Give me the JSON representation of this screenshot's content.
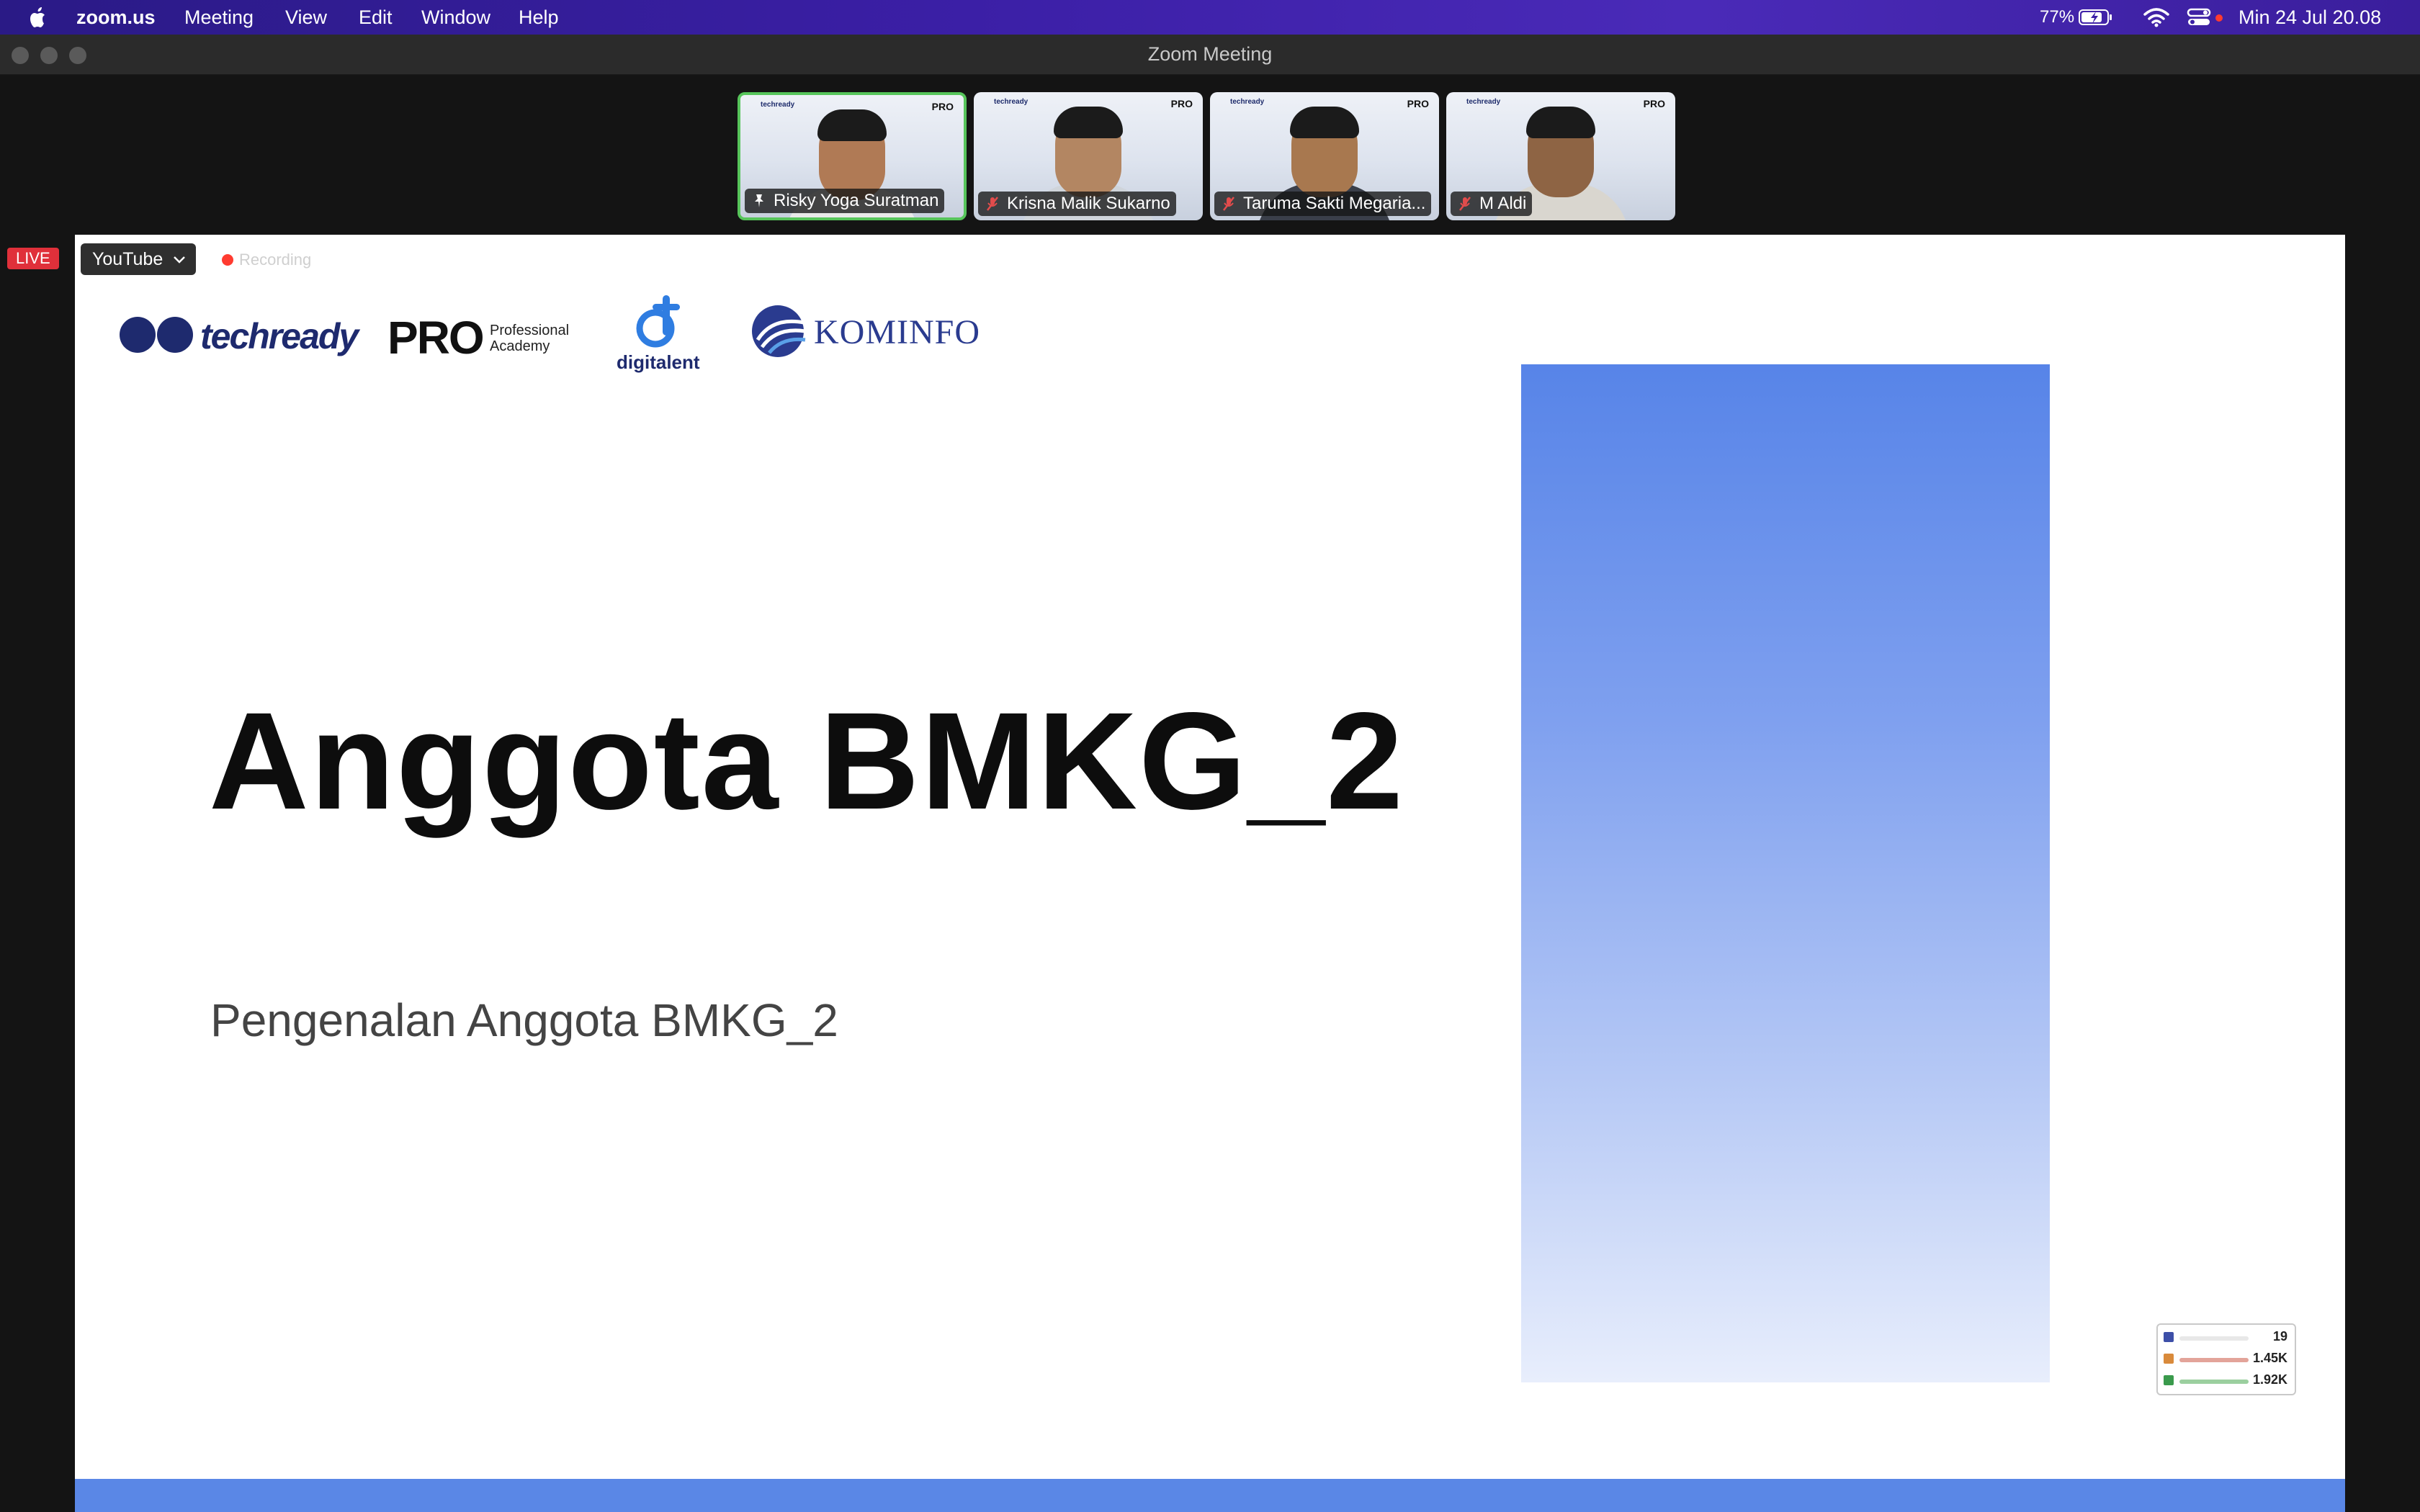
{
  "menubar": {
    "app_name": "zoom.us",
    "items": [
      "Meeting",
      "View",
      "Edit",
      "Window",
      "Help"
    ],
    "battery_percent": "77%",
    "datetime": "Min 24 Jul  20.08"
  },
  "window": {
    "title": "Zoom Meeting"
  },
  "participants": [
    {
      "name": "Risky Yoga Suratman",
      "active": true,
      "muted": false
    },
    {
      "name": "Krisna Malik Sukarno",
      "active": false,
      "muted": true
    },
    {
      "name": "Taruma Sakti Megaria...",
      "active": false,
      "muted": true
    },
    {
      "name": "M Aldi",
      "active": false,
      "muted": true
    }
  ],
  "tile_banner": {
    "brand": "techready",
    "pro": "PRO"
  },
  "live_controls": {
    "live_label": "LIVE",
    "stream_target": "YouTube",
    "recording_label": "Recording"
  },
  "slide": {
    "logos": {
      "techready": "techready",
      "pro": "PRO",
      "pro_sub_1": "Professional",
      "pro_sub_2": "Academy",
      "digitalent": "digitalent",
      "kominfo": "KOMINFO"
    },
    "title": "Anggota BMKG_2",
    "subtitle": "Pengenalan Anggota BMKG_2",
    "accent_color": "#5784e8"
  },
  "stats_widget": {
    "rows": [
      "19",
      "1.45K",
      "1.92K"
    ]
  }
}
